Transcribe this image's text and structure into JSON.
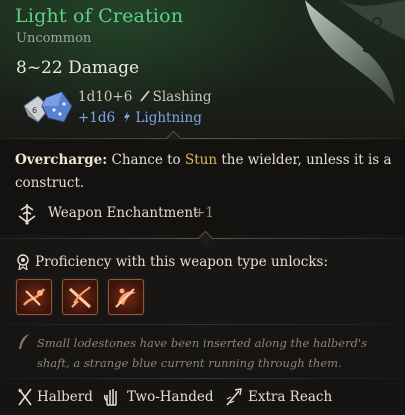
{
  "item": {
    "name": "Light of Creation",
    "rarity": "Uncommon",
    "damage_range": "8~22 Damage",
    "damage_lines": [
      {
        "formula": "1d10+6",
        "type": "Slashing",
        "icon": "slashing-icon",
        "color": "#cfc8b8"
      },
      {
        "formula": "+1d6",
        "type": "Lightning",
        "icon": "lightning-icon",
        "color": "#7fa7e8"
      }
    ]
  },
  "overcharge": {
    "key": "Overcharge:",
    "text_before": "Chance to",
    "highlight": "Stun",
    "text_after": "the wielder, unless it is a construct."
  },
  "enchantment": {
    "label": "Weapon Enchantment",
    "bonus": "+1",
    "icon": "enchantment-icon"
  },
  "proficiency": {
    "label": "Proficiency with this weapon type unlocks:",
    "actions": [
      {
        "name": "action-slot-1",
        "icon": "flourish-action-icon"
      },
      {
        "name": "action-slot-2",
        "icon": "lacerate-action-icon"
      },
      {
        "name": "action-slot-3",
        "icon": "cleave-action-icon"
      }
    ]
  },
  "lore": "Small lodestones have been inserted along the halberd's shaft, a strange blue current running through them.",
  "properties": [
    {
      "label": "Halberd",
      "icon": "halberd-icon"
    },
    {
      "label": "Two-Handed",
      "icon": "two-handed-icon"
    },
    {
      "label": "Extra Reach",
      "icon": "extra-reach-icon"
    }
  ],
  "colors": {
    "rarity_green": "#5ed08a",
    "highlight_gold": "#e2b84e",
    "lightning_blue": "#7fa7e8",
    "lore_gray": "#8b857a"
  }
}
